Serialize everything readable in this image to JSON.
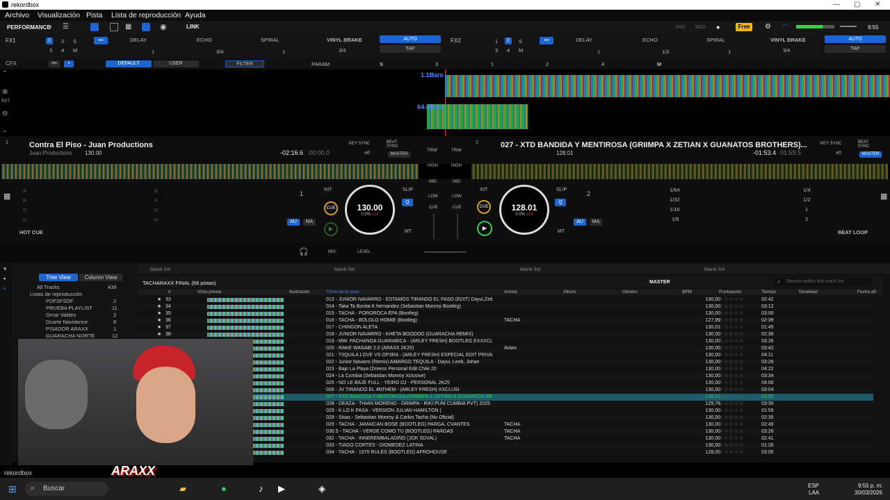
{
  "app": {
    "title": "rekordbox",
    "controls": [
      "—",
      "▢",
      "✕"
    ]
  },
  "menu": [
    "Archivo",
    "Visualización",
    "Pista",
    "Lista de reproducción",
    "Ayuda"
  ],
  "toolbar": {
    "mode": "PERFORMANCE",
    "link": "LINK",
    "pad": "PAD",
    "midi": "MIDI",
    "plan": "Free",
    "clock": "9:55"
  },
  "fx1": {
    "label": "FX1",
    "decks": [
      "1",
      "2",
      "S",
      "3",
      "4",
      "M"
    ],
    "effects": [
      "DELAY",
      "ECHO",
      "SPIRAL",
      "VINYL BRAKE"
    ],
    "values": [
      "1",
      "3/4",
      "1",
      "3/4"
    ],
    "auto": "AUTO",
    "tap": "TAP"
  },
  "fx2": {
    "label": "FX2",
    "decks": [
      "1",
      "2",
      "S",
      "3",
      "4",
      "M"
    ],
    "effects": [
      "DELAY",
      "ECHO",
      "SPIRAL",
      "VINYL BRAKE"
    ],
    "values": [
      "1",
      "1/2",
      "1",
      "3/4"
    ],
    "auto": "AUTO",
    "tap": "TAP"
  },
  "cfx": {
    "label": "CFX",
    "default": "DEFAULT",
    "user": "USER",
    "filter": "FILTER",
    "param": "PARAM",
    "s": "S",
    "n3": "3",
    "n1": "1",
    "n2": "2",
    "n4": "4",
    "m": "M"
  },
  "waveform": {
    "bars1": "1.1Bars",
    "bars2": "64.4Bars",
    "rst": "RST"
  },
  "deck1": {
    "num": "1",
    "title": "Contra El Piso - Juan Productions",
    "artist": "Juan Productions",
    "bpm_small": "130.00",
    "time_remain": "-02:16.6",
    "time_elapsed": "00:00.0",
    "key_sync": "KEY SYNC",
    "beat_sync": "BEAT SYNC",
    "key_offset": "±0",
    "master": "MASTER",
    "bpm": "130.00",
    "pitch": "0.0%",
    "range": "±16",
    "hotcue": "HOT CUE",
    "loop": "1",
    "int": "INT",
    "slip": "SLIP",
    "q": "Q",
    "au": "AU",
    "ma": "MA",
    "mt": "MT",
    "cue": "CUE",
    "pads": [
      "A",
      "B",
      "C",
      "D",
      "E",
      "F",
      "G",
      "H"
    ]
  },
  "deck2": {
    "num": "2",
    "title": "027 - XTD BANDIDA Y MENTIROSA (GRIIMPA X ZETIAN X GUANATOS BROTHERS)...",
    "bpm_small": "128.01",
    "time_remain": "-01:53.4",
    "time_elapsed": "01:59.5",
    "key_sync": "KEY SYNC",
    "beat_sync": "BEAT SYNC",
    "key_offset": "±0",
    "master": "MASTER",
    "bpm": "128.01",
    "pitch": "0.0%",
    "range": "±16",
    "loop": "2",
    "int": "INT",
    "slip": "SLIP",
    "q": "Q",
    "au": "AU",
    "ma": "MA",
    "mt": "MT",
    "cue": "CUE",
    "beatloop": "BEAT LOOP",
    "loops": [
      "1/64",
      "1/4",
      "1/32",
      "1/2",
      "1/16",
      "1",
      "1/8",
      "2"
    ]
  },
  "mixer": {
    "trim": "TRIM",
    "high": "HIGH",
    "mid": "MID",
    "low": "LOW",
    "cue": "CUE",
    "mix": "MIX",
    "level": "LEVEL"
  },
  "browser": {
    "tabs": [
      "blank list",
      "blank list",
      "blank list",
      "blank list"
    ],
    "tree_view": "Tree View",
    "column_view": "Column View",
    "all_tracks": "All Tracks",
    "all_tracks_count": "439",
    "playlists_label": "Listas de reproducción",
    "playlists": [
      {
        "name": "PDFSFSDF",
        "count": "2"
      },
      {
        "name": "PRUEBA PLAYLIST",
        "count": "11"
      },
      {
        "name": "Omar Valdes",
        "count": "2"
      },
      {
        "name": "Duarte Navidance",
        "count": "6"
      },
      {
        "name": "PISADOR ARAXX",
        "count": "1"
      },
      {
        "name": "GUARACHA NORTE",
        "count": "12"
      }
    ],
    "list_title": "TACHARAXX FINAL (66 pistas)",
    "master": "MASTER",
    "search_placeholder": "Search within this track list",
    "columns": [
      "#",
      "Vista previa",
      "Ilustración",
      "Título de la pista",
      "Artista",
      "Álbum",
      "Género",
      "BPM",
      "Puntuación",
      "Tiempo",
      "Tonalidad",
      "Fecha añ"
    ]
  },
  "tracks": [
    {
      "n": "33",
      "title": "013 - JUNIOR NAVARRO - ESTAMOS TIRANDO EL PASO (EDIT) Dayvi,Zeti",
      "artist": "",
      "bpm": "130,00",
      "time": "02:42"
    },
    {
      "n": "34",
      "title": "014 - Taka Ta Bonita K hernandez (Sebastian Monroy Bootleg)",
      "artist": "",
      "bpm": "130,00",
      "time": "03:12"
    },
    {
      "n": "35",
      "title": "015 - TACHA - POROROCA EPA (Bootleg)",
      "artist": "",
      "bpm": "130,00",
      "time": "03:00"
    },
    {
      "n": "36",
      "title": "016 - TACHA - BOLOLO HOMIE (Bootleg)",
      "artist": "TACHA",
      "bpm": "127,99",
      "time": "02:39"
    },
    {
      "n": "37",
      "title": "017 - CHINGON ALETA",
      "artist": "",
      "bpm": "130,01",
      "time": "01:45"
    },
    {
      "n": "38",
      "title": "018 - JUNIOR NAVARRO - KHETA BOODOO (GUARACHA REMIX)",
      "artist": "",
      "bpm": "130,00",
      "time": "02:38"
    },
    {
      "n": "",
      "title": "019 - MW. PACHANGA GUARABICA - (ARLEY FRESH) BOOTLEG EXXXCL",
      "artist": "",
      "bpm": "130,00",
      "time": "03:26"
    },
    {
      "n": "",
      "title": "020 - RAKE WASABI 2.0 (ARAXX 2K25)",
      "artist": "Araxx",
      "bpm": "130,00",
      "time": "03:42"
    },
    {
      "n": "",
      "title": "021 - T3QUILA LOVE VS OP3RA - (ARLEY FRESH) ESPECIAL EDIT PRIVA",
      "artist": "",
      "bpm": "130,00",
      "time": "04:11"
    },
    {
      "n": "",
      "title": "022 - Junior Navarro (Remix) AMARGO TEQUILA - Dayvi, Leeb, Johan",
      "artist": "",
      "bpm": "130,00",
      "time": "03:26"
    },
    {
      "n": "",
      "title": "023 - Bajo La Playa (Dreess Personal Edit Chile 20",
      "artist": "",
      "bpm": "130,00",
      "time": "04:22"
    },
    {
      "n": "",
      "title": "024 - La Cumbia (Sebastian Monroy Xclusive)",
      "artist": "",
      "bpm": "130,00",
      "time": "03:34"
    },
    {
      "n": "",
      "title": "025 - NO LE BAJE FULL - YEIRO DJ - PERSONAL 2K25",
      "artist": "",
      "bpm": "130,00",
      "time": "04:00"
    },
    {
      "n": "",
      "title": "026 - JV TIRANDO EL 4NTHEM - (ARLEY FRESH) XXCLUSI",
      "artist": "",
      "bpm": "130,00",
      "time": "03:04"
    },
    {
      "n": "",
      "title": "027 - XTD BANDIDA Y MENTIROSA (GRIIMPA X ZETIAN X GUANATOS BR",
      "artist": "",
      "bpm": "128,01",
      "time": "03:53",
      "active": true
    },
    {
      "n": "",
      "title": "028 - DEAZA - THIAN MORENO - GRIMPA - RIKI PUM CUMBIA PVT) 2025",
      "artist": "",
      "bpm": "129,78",
      "time": "03:30"
    },
    {
      "n": "",
      "title": "029 - K LO K PASA - VERSION JULIAN HAMILTON (",
      "artist": "",
      "bpm": "130,00",
      "time": "01:59"
    },
    {
      "n": "",
      "title": "029 - Sisas - Sebastian Monroy & Carlos Tacha (No Oficial)",
      "artist": "",
      "bpm": "130,00",
      "time": "02:35"
    },
    {
      "n": "",
      "title": "029 - TACHA - JAMAICAN BOSE (BOOTLEG) PARGA, CVANTES",
      "artist": "TACHA",
      "bpm": "130,00",
      "time": "02:49"
    },
    {
      "n": "",
      "title": "030.5 - TACHA - VERDE COMO TÚ (BOOTLEG) PARGAS",
      "artist": "TACHA",
      "bpm": "130,00",
      "time": "03:26"
    },
    {
      "n": "",
      "title": "032 - TACHA - INNEREMBALADIÑO (JOK SDVAL)",
      "artist": "TACHA",
      "bpm": "130,00",
      "time": "02:41"
    },
    {
      "n": "",
      "title": "033 - TIAGO CORTES - DIOMEDEZ LATINA",
      "artist": "",
      "bpm": "130,00",
      "time": "01:26"
    },
    {
      "n": "",
      "title": "034 - TACHA - 1970 RULES (BOOTLEG) AFROHOUSE",
      "artist": "",
      "bpm": "128,00",
      "time": "03:05"
    }
  ],
  "taskbar": {
    "search": "Buscar",
    "lang1": "ESP",
    "lang2": "LAA",
    "time": "9:55 p. m.",
    "date": "30/03/2026",
    "app_label": "rekordbox"
  },
  "overlay": {
    "logo_text": "ARAXX"
  },
  "colors": {
    "accent_blue": "#1c66d4",
    "highlight_green": "#2bd84a",
    "free_badge": "#f5b400"
  }
}
